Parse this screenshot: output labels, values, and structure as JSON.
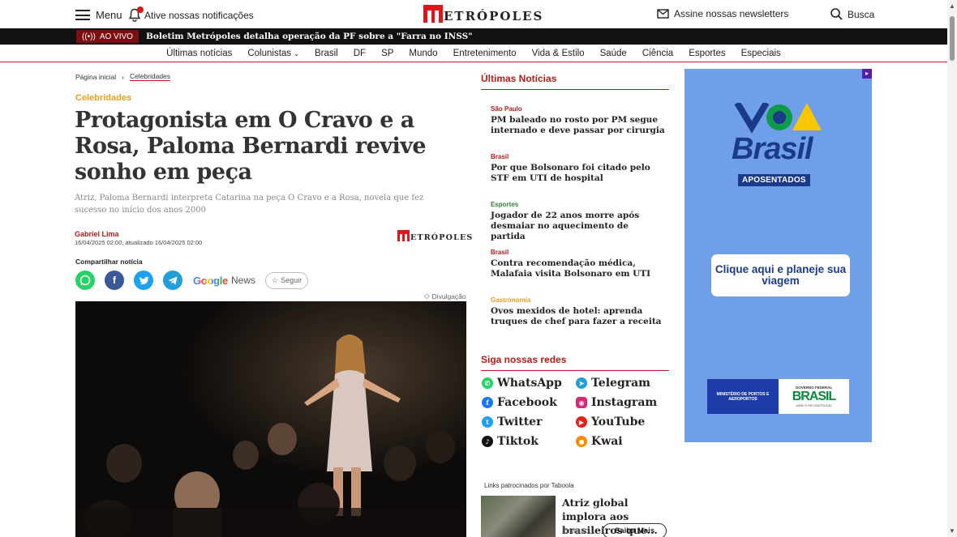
{
  "header": {
    "menu_label": "Menu",
    "notifications_label": "Ative nossas notificações",
    "logo_text": "ETRÓPOLES",
    "newsletter_label": "Assine nossas newsletters",
    "search_label": "Busca",
    "brand_color": "#e0141c"
  },
  "live": {
    "badge": "AO VIVO",
    "text": "Boletim Metrópoles detalha operação da PF sobre a \"Farra no INSS\""
  },
  "nav": [
    "Últimas notícias",
    "Colunistas",
    "Brasil",
    "DF",
    "SP",
    "Mundo",
    "Entretenimento",
    "Vida & Estilo",
    "Saúde",
    "Ciência",
    "Esportes",
    "Especiais"
  ],
  "article": {
    "breadcrumb": [
      "Página inicial",
      "Celebridades"
    ],
    "category": "Celebridades",
    "headline": "Protagonista em O Cravo e a Rosa, Paloma Bernardi revive sonho em peça",
    "subtitle": "Atriz, Paloma Bernardi interpreta Catarina na peça O Cravo e a Rosa, novela que fez sucesso no início dos anos 2000",
    "author": "Gabriel Lima",
    "dates": "16/04/2025 02:00, atualizado 16/04/2025 02:00",
    "source_logo": "ETRÓPOLES",
    "share_label": "Compartilhar notícia",
    "google_news": "Google",
    "google_news_suffix": "News",
    "follow_label": "Seguir",
    "photo_credit": "Divulgação"
  },
  "latest": {
    "title": "Últimas Notícias",
    "items": [
      {
        "tag": "São Paulo",
        "tag_color": "#b01c1c",
        "title": "PM baleado no rosto por PM segue internado e deve passar por cirurgia"
      },
      {
        "tag": "Brasil",
        "tag_color": "#b01c1c",
        "title": "Por que Bolsonaro foi citado pelo STF em UTI de hospital"
      },
      {
        "tag": "Esportes",
        "tag_color": "#2e7d32",
        "title": "Jogador de 22 anos morre após desmaiar no aquecimento de partida"
      },
      {
        "tag": "Brasil",
        "tag_color": "#b01c1c",
        "title": "Contra recomendação médica, Malafaia visita Bolsonaro em UTI"
      },
      {
        "tag": "Gastronomia",
        "tag_color": "#e6a020",
        "title": "Ovos mexidos de hotel: aprenda truques de chef para fazer a receita"
      }
    ]
  },
  "social": {
    "title": "Siga nossas redes",
    "items": [
      {
        "name": "WhatsApp",
        "color": "#25d366",
        "icon": "whatsapp-icon"
      },
      {
        "name": "Telegram",
        "color": "#229ed9",
        "icon": "telegram-icon"
      },
      {
        "name": "Facebook",
        "color": "#1877f2",
        "icon": "facebook-icon"
      },
      {
        "name": "Instagram",
        "color": "#d62976",
        "icon": "instagram-icon"
      },
      {
        "name": "Twitter",
        "color": "#1da1f2",
        "icon": "twitter-icon"
      },
      {
        "name": "YouTube",
        "color": "#e62117",
        "icon": "youtube-icon"
      },
      {
        "name": "Tiktok",
        "color": "#111111",
        "icon": "tiktok-icon"
      },
      {
        "name": "Kwai",
        "color": "#ff8a00",
        "icon": "kwai-icon"
      }
    ]
  },
  "taboola": {
    "label": "Links patrocinados por Taboola",
    "title": "Atriz global implora aos brasileiros que...",
    "source": "Emagreci...",
    "button": "Saiba Mais"
  },
  "ad": {
    "logo_text": "Brasil",
    "tag": "APOSENTADOS",
    "cta": "Clique aqui e planeje sua viagem",
    "ministry": "MINISTÉRIO DE PORTOS E AEROPORTOS",
    "gov_top": "GOVERNO FEDERAL",
    "gov_brand": "BRASIL",
    "gov_bottom": "UNIÃO E RECONSTRUÇÃO",
    "bg_color": "#6e9fe8"
  }
}
